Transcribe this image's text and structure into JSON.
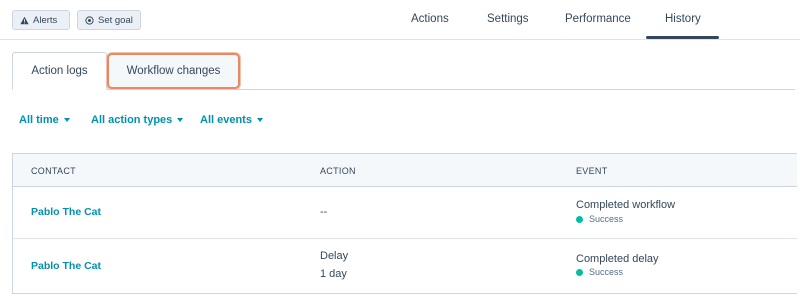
{
  "header": {
    "alerts_label": "Alerts",
    "set_goal_label": "Set goal",
    "nav": [
      {
        "label": "Actions"
      },
      {
        "label": "Settings"
      },
      {
        "label": "Performance"
      },
      {
        "label": "History"
      }
    ],
    "active_nav": "History"
  },
  "tabs": [
    {
      "label": "Action logs"
    },
    {
      "label": "Workflow changes"
    }
  ],
  "filters": [
    {
      "label": "All time"
    },
    {
      "label": "All action types"
    },
    {
      "label": "All events"
    }
  ],
  "table": {
    "columns": [
      "CONTACT",
      "ACTION",
      "EVENT"
    ],
    "rows": [
      {
        "contact": "Pablo The Cat",
        "action_line1": "--",
        "action_line2": "",
        "event": "Completed workflow",
        "status": "Success"
      },
      {
        "contact": "Pablo The Cat",
        "action_line1": "Delay",
        "action_line2": "1 day",
        "event": "Completed delay",
        "status": "Success"
      }
    ]
  },
  "colors": {
    "accent_link": "#0091ae",
    "text": "#33475b",
    "success": "#00bda5",
    "highlight_border": "#e68a65"
  }
}
